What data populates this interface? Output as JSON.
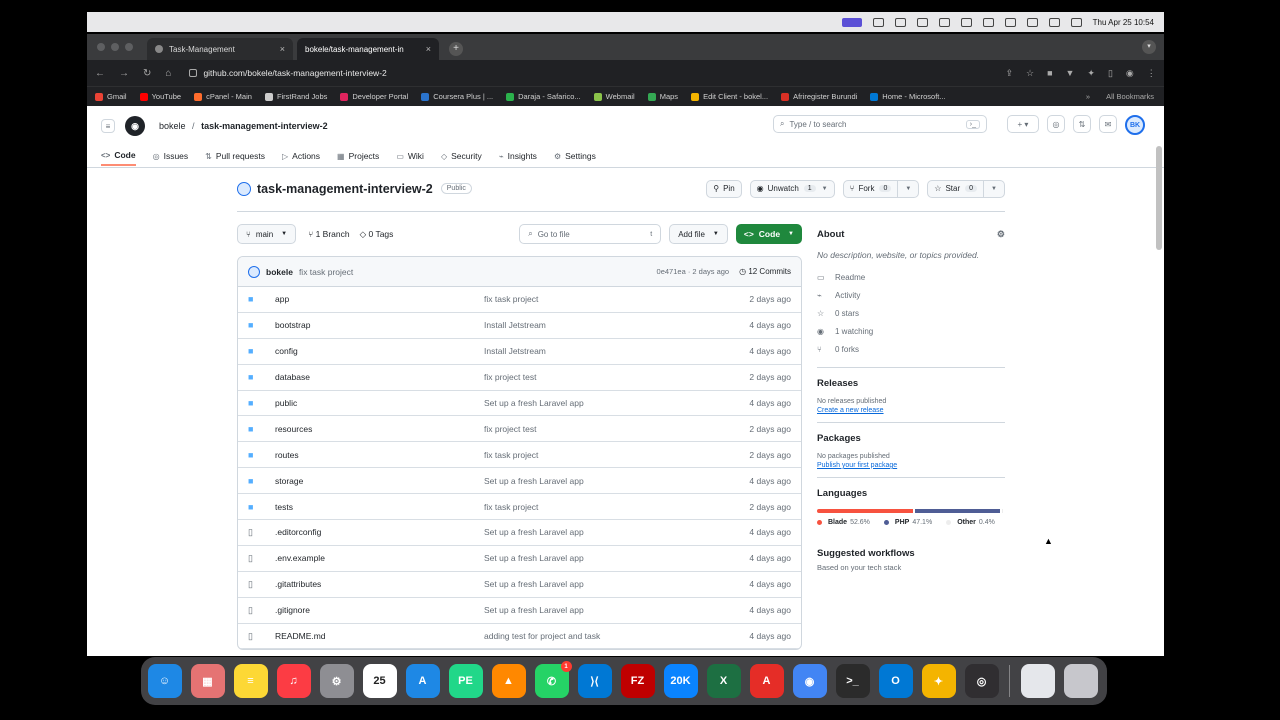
{
  "menubar": {
    "clock": "Thu Apr 25  10:54"
  },
  "tabs": [
    {
      "label": "Task-Management",
      "active": false
    },
    {
      "label": "bokele/task-management-in",
      "active": true
    }
  ],
  "toolbar": {
    "url": "github.com/bokele/task-management-interview-2"
  },
  "bookmarks": {
    "items": [
      {
        "label": "Gmail",
        "color": "#ea4335"
      },
      {
        "label": "YouTube",
        "color": "#ff0000"
      },
      {
        "label": "cPanel - Main",
        "color": "#ff6c2c"
      },
      {
        "label": "FirstRand Jobs",
        "color": "#cccccc"
      },
      {
        "label": "Developer Portal",
        "color": "#e0245e"
      },
      {
        "label": "Coursera Plus | ...",
        "color": "#2a73cc"
      },
      {
        "label": "Daraja - Safarico...",
        "color": "#2bb24c"
      },
      {
        "label": "Webmail",
        "color": "#8bc34a"
      },
      {
        "label": "Maps",
        "color": "#34a853"
      },
      {
        "label": "Edit Client - bokel...",
        "color": "#f4b400"
      },
      {
        "label": "Afriregister Burundi",
        "color": "#d93025"
      },
      {
        "label": "Home - Microsoft...",
        "color": "#0078d4"
      }
    ],
    "more": "»",
    "all": "All Bookmarks"
  },
  "gh": {
    "owner": "bokele",
    "sep": "/",
    "repo": "task-management-interview-2",
    "search_placeholder": "Type / to search",
    "nav": [
      {
        "label": "Code",
        "icon": "<>",
        "active": true
      },
      {
        "label": "Issues",
        "icon": "◎"
      },
      {
        "label": "Pull requests",
        "icon": "⇅"
      },
      {
        "label": "Actions",
        "icon": "▷"
      },
      {
        "label": "Projects",
        "icon": "▦"
      },
      {
        "label": "Wiki",
        "icon": "▭"
      },
      {
        "label": "Security",
        "icon": "◇"
      },
      {
        "label": "Insights",
        "icon": "⌁"
      },
      {
        "label": "Settings",
        "icon": "⚙"
      }
    ]
  },
  "repo": {
    "name": "task-management-interview-2",
    "visibility": "Public",
    "pin": "Pin",
    "unwatch": "Unwatch",
    "watch_count": "1",
    "fork": "Fork",
    "fork_count": "0",
    "star": "Star",
    "star_count": "0",
    "branch": "main",
    "branches": "1 Branch",
    "tags": "0 Tags",
    "goto_placeholder": "Go to file",
    "goto_key": "t",
    "add_file": "Add file",
    "code": "Code",
    "latest": {
      "author": "bokele",
      "message": "fix task project",
      "hash": "0e471ea · 2 days ago",
      "commits": "12 Commits"
    },
    "files": [
      {
        "name": "app",
        "type": "dir",
        "message": "fix task project",
        "date": "2 days ago"
      },
      {
        "name": "bootstrap",
        "type": "dir",
        "message": "Install Jetstream",
        "date": "4 days ago"
      },
      {
        "name": "config",
        "type": "dir",
        "message": "Install Jetstream",
        "date": "4 days ago"
      },
      {
        "name": "database",
        "type": "dir",
        "message": "fix project test",
        "date": "2 days ago"
      },
      {
        "name": "public",
        "type": "dir",
        "message": "Set up a fresh Laravel app",
        "date": "4 days ago"
      },
      {
        "name": "resources",
        "type": "dir",
        "message": "fix project test",
        "date": "2 days ago"
      },
      {
        "name": "routes",
        "type": "dir",
        "message": "fix task project",
        "date": "2 days ago"
      },
      {
        "name": "storage",
        "type": "dir",
        "message": "Set up a fresh Laravel app",
        "date": "4 days ago"
      },
      {
        "name": "tests",
        "type": "dir",
        "message": "fix task project",
        "date": "2 days ago"
      },
      {
        "name": ".editorconfig",
        "type": "file",
        "message": "Set up a fresh Laravel app",
        "date": "4 days ago"
      },
      {
        "name": ".env.example",
        "type": "file",
        "message": "Set up a fresh Laravel app",
        "date": "4 days ago"
      },
      {
        "name": ".gitattributes",
        "type": "file",
        "message": "Set up a fresh Laravel app",
        "date": "4 days ago"
      },
      {
        "name": ".gitignore",
        "type": "file",
        "message": "Set up a fresh Laravel app",
        "date": "4 days ago"
      },
      {
        "name": "README.md",
        "type": "file",
        "message": "adding test for project and task",
        "date": "4 days ago"
      }
    ]
  },
  "about": {
    "title": "About",
    "description": "No description, website, or topics provided.",
    "stats": [
      {
        "icon": "▭",
        "label": "Readme"
      },
      {
        "icon": "⌁",
        "label": "Activity"
      },
      {
        "icon": "☆",
        "label": "0 stars"
      },
      {
        "icon": "◉",
        "label": "1 watching"
      },
      {
        "icon": "⑂",
        "label": "0 forks"
      }
    ],
    "releases": {
      "title": "Releases",
      "empty": "No releases published",
      "link": "Create a new release"
    },
    "packages": {
      "title": "Packages",
      "empty": "No packages published",
      "link": "Publish your first package"
    },
    "languages": {
      "title": "Languages",
      "items": [
        {
          "name": "Blade",
          "pct": "52.6%",
          "value": 52.6,
          "color": "#f7523f"
        },
        {
          "name": "PHP",
          "pct": "47.1%",
          "value": 47.1,
          "color": "#4f5d95"
        },
        {
          "name": "Other",
          "pct": "0.4%",
          "value": 0.4,
          "color": "#ededed"
        }
      ]
    },
    "workflows": {
      "title": "Suggested workflows",
      "subtitle": "Based on your tech stack"
    }
  },
  "dock": [
    {
      "name": "finder",
      "color": "#1e88e5",
      "glyph": "☺"
    },
    {
      "name": "launchpad",
      "color": "#e57373",
      "glyph": "▦"
    },
    {
      "name": "notes",
      "color": "#fdd835",
      "glyph": "≡"
    },
    {
      "name": "music",
      "color": "#fc3c44",
      "glyph": "♫"
    },
    {
      "name": "system-settings",
      "color": "#8e8e93",
      "glyph": "⚙"
    },
    {
      "name": "calendar",
      "color": "#ffffff",
      "glyph": "25"
    },
    {
      "name": "app-store",
      "color": "#1e88e5",
      "glyph": "A"
    },
    {
      "name": "phpstorm",
      "color": "#21d789",
      "glyph": "PE"
    },
    {
      "name": "vlc",
      "color": "#ff8800",
      "glyph": "▲"
    },
    {
      "name": "whatsapp",
      "color": "#25d366",
      "glyph": "✆",
      "badge": "1"
    },
    {
      "name": "vscode",
      "color": "#0078d4",
      "glyph": "⟩⟨"
    },
    {
      "name": "filezilla",
      "color": "#bf0000",
      "glyph": "FZ"
    },
    {
      "name": "screen-sharing",
      "color": "#0a84ff",
      "glyph": "20K"
    },
    {
      "name": "excel",
      "color": "#1d6f42",
      "glyph": "X"
    },
    {
      "name": "acrobat",
      "color": "#e52d27",
      "glyph": "A"
    },
    {
      "name": "chrome",
      "color": "#4285f4",
      "glyph": "◉"
    },
    {
      "name": "terminal",
      "color": "#2b2b2b",
      "glyph": ">_"
    },
    {
      "name": "outlook",
      "color": "#0078d4",
      "glyph": "O"
    },
    {
      "name": "tableplus",
      "color": "#f4b400",
      "glyph": "✦"
    },
    {
      "name": "obs",
      "color": "#302e31",
      "glyph": "◎"
    }
  ]
}
